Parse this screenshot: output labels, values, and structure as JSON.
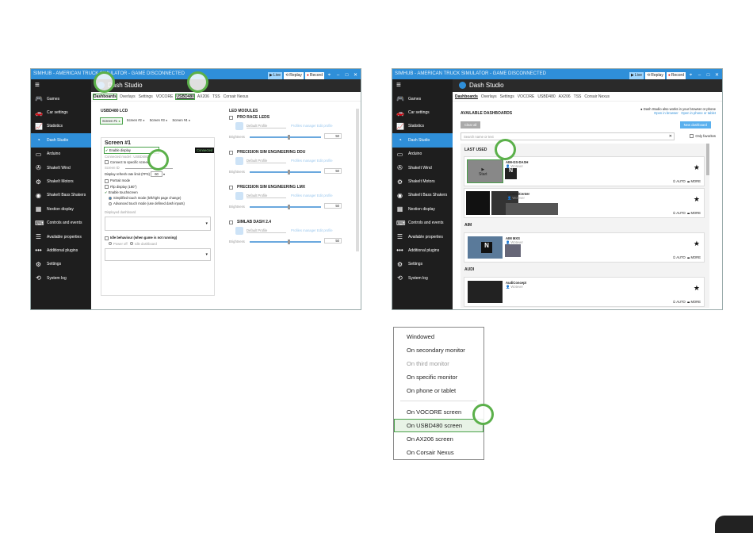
{
  "win1": {
    "title": "SIMHUB - AMERICAN TRUCK SIMULATOR - GAME DISCONNECTED",
    "title_buttons": [
      "Live",
      "Replay",
      "Record"
    ],
    "header": "Dash Studio",
    "tabs": [
      "Dashboards",
      "Overlays",
      "Settings",
      "VOCORE",
      "USBD480",
      "AX206",
      "TSS",
      "Corsair Nexus"
    ],
    "section_title": "USBD480 LCD",
    "screens": [
      "Screen #1",
      "Screen #2",
      "Screen #3",
      "Screen #4"
    ],
    "screen_heading": "Screen #1",
    "enable_display": "Enable display",
    "connected_badge": "Connected",
    "connected_model": "Connected model : USBD480",
    "connect_specific": "Connect to specific screen",
    "screen_id": "Screen ID",
    "refresh_label": "Display refresh rate limit (FPS)",
    "refresh_value": "60",
    "portrait": "Portrait mode",
    "flip": "Flip display (180°)",
    "enable_touch": "Enable touchscreen",
    "touch_simple": "Simplified touch mode (left/right page change)",
    "touch_advanced": "Advanced touch mode (use defined dash inputs)",
    "displayed_dashboard": "Displayed dashboard",
    "idle_behaviour": "Idle behaviour (when game is not running)",
    "power_off": "Power off",
    "idle_dashboard": "Idle dashboard",
    "led_title": "LED MODULES",
    "led_modules": [
      "PRO RACE LEDS",
      "PRECISION SIM ENGINEERING DDU",
      "PRECISION SIM ENGINEERING LMX",
      "SIMLAB DASH 2.4"
    ],
    "default_profile": "Default Profile",
    "brightness": "Brightness",
    "brightness_value": "50",
    "profile_manager": "Profiles manager   Edit profile"
  },
  "sidebar": [
    "Games",
    "Car settings",
    "Statistics",
    "Dash Studio",
    "Arduino",
    "ShakeIt Wind",
    "ShakeIt Motors",
    "ShakeIt Bass Shakers",
    "Nextion display",
    "Controls and events",
    "Available properties",
    "Additional plugins",
    "Settings",
    "System log"
  ],
  "sidebar_icons": [
    "gamepad-icon",
    "car-icon",
    "chart-icon",
    "gauge-icon",
    "arduino-icon",
    "fan-icon",
    "motor-icon",
    "speaker-icon",
    "nextion-icon",
    "keyboard-icon",
    "list-icon",
    "dots-icon",
    "gear-icon",
    "history-icon"
  ],
  "win2": {
    "title": "SIMHUB - AMERICAN TRUCK SIMULATOR - GAME DISCONNECTED",
    "header": "Dash Studio",
    "tabs": [
      "Dashboards",
      "Overlays",
      "Settings",
      "VOCORE",
      "USBD480",
      "AX206",
      "TSS",
      "Corsair Nexus"
    ],
    "available": "AVAILABLE DASHBOARDS",
    "info": "Dash Studio also works in your browser or phone",
    "open_browser": "Open in browser",
    "open_phone": "Open in phone or tablet",
    "clear_all": "Clear all",
    "new_dashboard": "New dashboard",
    "search_placeholder": "Search name or text",
    "only_favorites": "Only favorites",
    "last_used": "LAST USED",
    "aim_group": "AIM",
    "audi_group": "AUDI",
    "cards": [
      {
        "name": "AIM-GS-DASH",
        "author": "Wotever",
        "start": "Start"
      },
      {
        "name": "ControlCenter",
        "author": "Wotever"
      },
      {
        "name": "AIM MXS",
        "author": "Wotever"
      },
      {
        "name": "AudiConcept",
        "author": "Wotever"
      }
    ],
    "auto": "AUTO",
    "more": "MORE"
  },
  "menu": {
    "items": [
      "Windowed",
      "On secondary monitor",
      "On third monitor",
      "On specific monitor",
      "On phone or tablet",
      "On VOCORE screen",
      "On USBD480 screen",
      "On AX206 screen",
      "On Corsair Nexus"
    ],
    "selected": "On USBD480 screen",
    "disabled": "On third monitor"
  },
  "colors": {
    "accent": "#2f8fd9",
    "highlight": "#5bb04a",
    "sidebar": "#1e1e1e"
  }
}
